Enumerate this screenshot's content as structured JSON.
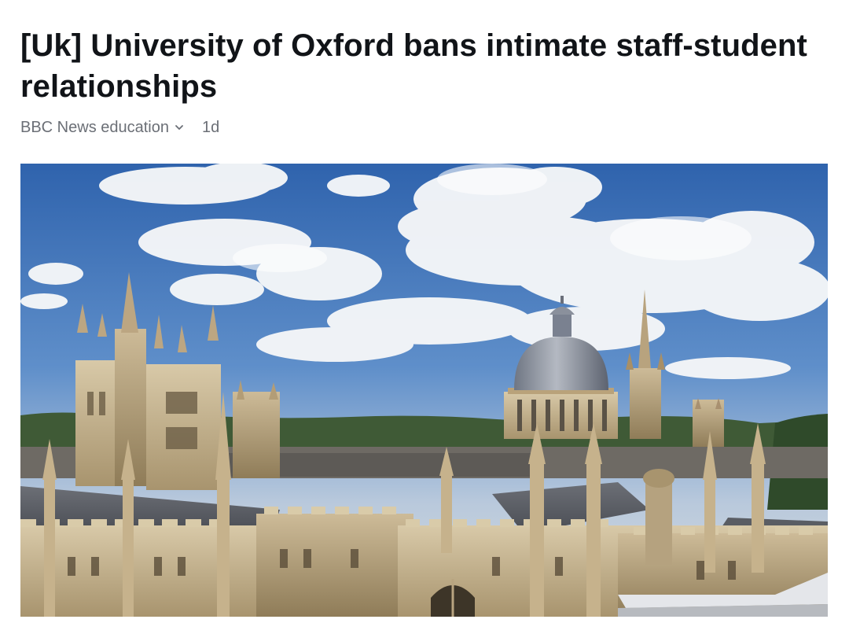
{
  "article": {
    "title": "[Uk] University of Oxford bans intimate staff-student relationships",
    "source": "BBC News education",
    "age": "1d"
  },
  "icons": {
    "source_menu": "chevron-down-icon"
  },
  "colors": {
    "title": "#111418",
    "meta": "#6b6f76",
    "sky": "#3f74b8",
    "stone": "#c9b796"
  }
}
